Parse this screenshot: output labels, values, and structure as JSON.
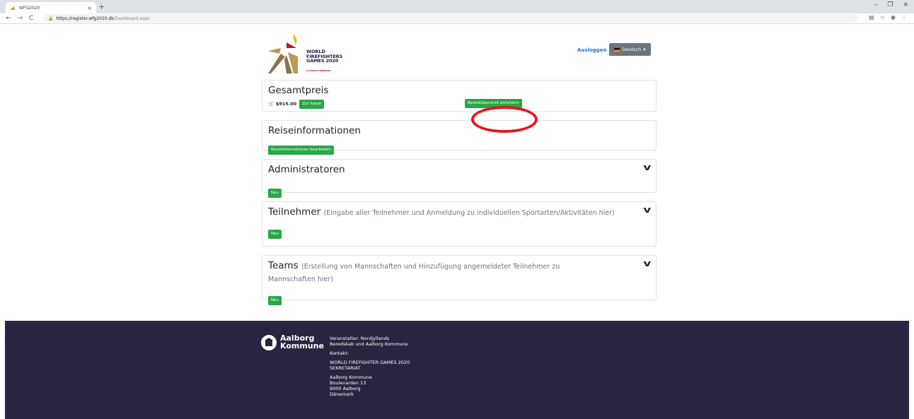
{
  "browser": {
    "tab_title": "WFG2020",
    "tab_close": "×",
    "new_tab": "+",
    "url_host": "https://register.wfg2020.dk",
    "url_path": "/Dashboard.aspx",
    "window_controls": [
      "–",
      "❐",
      "×"
    ]
  },
  "header": {
    "logo_text": [
      "WORLD",
      "FIREFIGHTERS",
      "GAMES 2020"
    ],
    "logo_sub": "AALBORG DENMARK",
    "logout_label": "Ausloggen",
    "language_label": "Deutsch"
  },
  "price_card": {
    "title": "Gesamtpreis",
    "price": "$915.00",
    "checkout_label": "Zur kasse",
    "order_overview_label": "Bestellübersicht anfordern"
  },
  "travel_card": {
    "title": "Reiseinformationen",
    "edit_label": "Reiseinformationen bearbeiten"
  },
  "admins_card": {
    "title": "Administratoren",
    "new_label": "Neu"
  },
  "participants_card": {
    "title": "Teilnehmer",
    "subtitle": "(Eingabe aller Teilnehmer und Anmeldung zu individuellen Sportarten/Aktivitäten hier)",
    "new_label": "Neu"
  },
  "teams_card": {
    "title": "Teams",
    "subtitle": "(Erstellung von Mannschaften und Hinzufügung angemeldeter Teilnehmer zu Mannschaften hier)",
    "new_label": "Neu"
  },
  "footer": {
    "logo_name": [
      "Aalborg",
      "Kommune"
    ],
    "organizer": [
      "Veranstalter: Nordjyllands",
      "Beredskab und Aalborg Kommune"
    ],
    "contact_label": "Kontakt:",
    "secretariat": [
      "WORLD FIREFIGHTER GAMES 2020",
      "SEKRETARIAT"
    ],
    "address": [
      "Aalborg Kommune",
      "Boulevarden 13",
      "9000 Aalborg",
      "Dänemark"
    ]
  },
  "colors": {
    "green": "#28a745",
    "link_blue": "#1a73e8",
    "footer_bg": "#2a2440",
    "highlight_red": "#e8141b"
  }
}
